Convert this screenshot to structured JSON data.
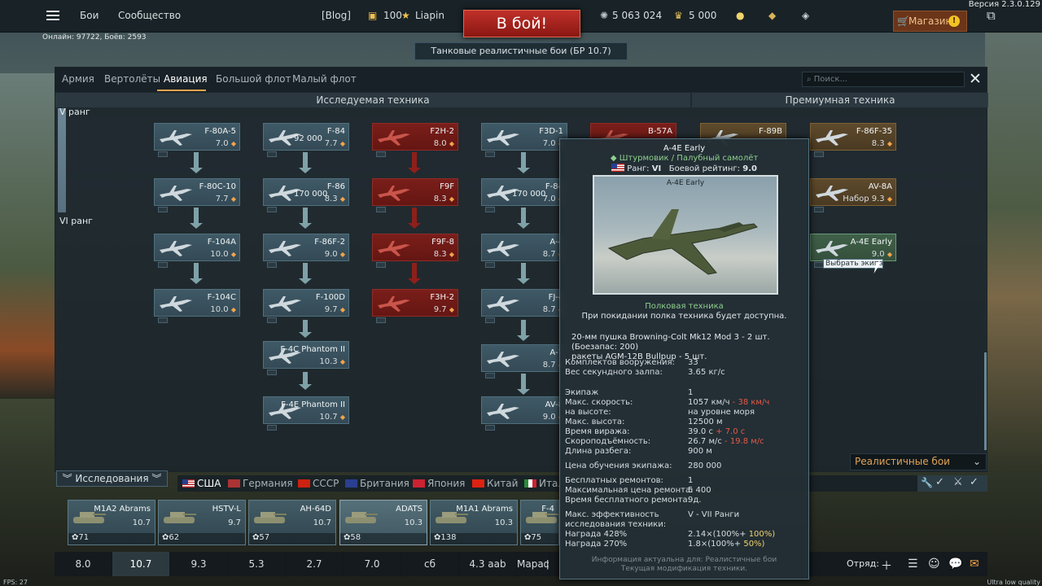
{
  "topbar": {
    "battles": "Бои",
    "community": "Сообщество",
    "blog": "[Blog]",
    "level": "100",
    "username": "Liapin",
    "battle_button": "В бой!",
    "silver": "5 063 024",
    "gold": "5 000",
    "shop": "Магазин",
    "version": "Версия 2.3.0.129",
    "online": "Онлайн: 97722, Боёв: 2593",
    "mode": "Танковые реалистичные бои (БР 10.7)"
  },
  "tabs": [
    {
      "label": "Армия"
    },
    {
      "label": "Вертолёты"
    },
    {
      "label": "Авиация"
    },
    {
      "label": "Большой флот"
    },
    {
      "label": "Малый флот"
    }
  ],
  "search_placeholder": "Поиск...",
  "sections": {
    "researched": "Исследуемая техника",
    "premium": "Премиумная техника"
  },
  "ranks": {
    "v": "V ранг",
    "vi": "VI ранг"
  },
  "vehicles": [
    {
      "name": "F-80A-5",
      "br": "7.0",
      "type": "normal"
    },
    {
      "name": "F-80C-10",
      "br": "7.7",
      "type": "normal"
    },
    {
      "name": "F-104A",
      "br": "10.0",
      "type": "normal"
    },
    {
      "name": "F-104C",
      "br": "10.0",
      "type": "normal"
    },
    {
      "name": "F-84",
      "br": "7.7",
      "xp": "92 000",
      "type": "normal"
    },
    {
      "name": "F-86",
      "br": "8.3",
      "xp": "170 000",
      "type": "normal"
    },
    {
      "name": "F-86F-2",
      "br": "9.0",
      "type": "normal"
    },
    {
      "name": "F-100D",
      "br": "9.7",
      "type": "normal"
    },
    {
      "name": "F-4C Phantom II",
      "br": "10.3",
      "type": "normal"
    },
    {
      "name": "F-4E Phantom II",
      "br": "10.7",
      "type": "normal"
    },
    {
      "name": "F2H-2",
      "br": "8.0",
      "type": "red"
    },
    {
      "name": "F9F",
      "br": "8.3",
      "type": "red"
    },
    {
      "name": "F9F-8",
      "br": "8.3",
      "type": "red"
    },
    {
      "name": "F3H-2",
      "br": "9.7",
      "type": "red"
    },
    {
      "name": "F3D-1",
      "br": "7.0",
      "type": "normal"
    },
    {
      "name": "F-84",
      "br": "7.0",
      "xp": "170 000",
      "type": "normal"
    },
    {
      "name": "A-4",
      "br": "8.7",
      "type": "normal"
    },
    {
      "name": "FJ-4",
      "br": "8.7",
      "type": "normal"
    },
    {
      "name": "A-7",
      "br": "8.7",
      "type": "normal"
    },
    {
      "name": "AV-8",
      "br": "9.0",
      "type": "normal"
    },
    {
      "name": "B-57A",
      "br": "",
      "type": "red"
    },
    {
      "name": "F-89B",
      "br": "",
      "type": "gold"
    },
    {
      "name": "F-86F-35",
      "br": "8.3",
      "type": "gold"
    },
    {
      "name": "AV-8A",
      "br": "Набор 9.3",
      "type": "gold"
    },
    {
      "name": "A-4E Early",
      "br": "9.0",
      "type": "sel"
    }
  ],
  "pick_crew": "Выбрать экипаж",
  "mode_select": "Реалистичные бои",
  "research_label": "Исследования",
  "nations": [
    {
      "name": "США"
    },
    {
      "name": "Германия"
    },
    {
      "name": "СССР"
    },
    {
      "name": "Британия"
    },
    {
      "name": "Япония"
    },
    {
      "name": "Китай"
    },
    {
      "name": "Италия"
    }
  ],
  "slots": [
    {
      "name": "M1A2 Abrams",
      "br": "10.7",
      "crew": "71"
    },
    {
      "name": "HSTV-L",
      "br": "9.7",
      "crew": "62"
    },
    {
      "name": "AH-64D",
      "br": "10.7",
      "crew": "57"
    },
    {
      "name": "ADATS",
      "br": "10.3",
      "crew": "58"
    },
    {
      "name": "M1A1 Abrams",
      "br": "10.3",
      "crew": "138"
    },
    {
      "name": "F-4",
      "br": "",
      "crew": "75"
    }
  ],
  "presets": [
    {
      "label": "8.0"
    },
    {
      "label": "10.7"
    },
    {
      "label": "9.3"
    },
    {
      "label": "5.3"
    },
    {
      "label": "2.7"
    },
    {
      "label": "7.0"
    },
    {
      "label": "сб"
    },
    {
      "label": "4.3 aab"
    },
    {
      "label": "Марафон"
    }
  ],
  "squad": "Отряд:",
  "fps": "FPS: 27",
  "quality": "Ultra low quality",
  "tooltip": {
    "title": "A-4E Early",
    "class": "Штурмовик / Палубный самолёт",
    "rank_label": "Ранг:",
    "rank": "VI",
    "br_label": "Боевой рейтинг:",
    "br": "9.0",
    "image_caption": "A-4E Early",
    "reg_title": "Полковая техника",
    "reg_note": "При покидании полка техника будет доступна.",
    "armament_1": "20-мм пушка Browning-Colt Mk12 Mod 3 - 2 шт. (Боезапас: 200)",
    "armament_2": "ракеты AGM-12B Bullpup - 5 шт.",
    "rows": [
      {
        "k": "Комплектов вооружения:",
        "v": "33",
        "extra": ""
      },
      {
        "k": "Вес секундного залпа:",
        "v": "3.65 кг/с",
        "extra": ""
      },
      {
        "k": "Экипаж",
        "v": "1",
        "extra": ""
      },
      {
        "k": "Макс. скорость:",
        "v": "1057 км/ч",
        "extra": "- 38 км/ч"
      },
      {
        "k": "на высоте:",
        "v": "на уровне моря",
        "extra": ""
      },
      {
        "k": "Макс. высота:",
        "v": "12500 м",
        "extra": ""
      },
      {
        "k": "Время виража:",
        "v": "39.0 с",
        "extra": "+ 7.0 с"
      },
      {
        "k": "Скороподъёмность:",
        "v": "26.7 м/с",
        "extra": "- 19.8 м/с"
      },
      {
        "k": "Длина разбега:",
        "v": "900 м",
        "extra": ""
      },
      {
        "k": "Цена обучения экипажа:",
        "v": "280 000",
        "extra": ""
      },
      {
        "k": "Бесплатных ремонтов:",
        "v": "1",
        "extra": ""
      },
      {
        "k": "Максимальная цена ремонта:",
        "v": "5 400",
        "extra": ""
      },
      {
        "k": "Время бесплатного ремонта:",
        "v": "9д.",
        "extra": ""
      },
      {
        "k": "Макс. эффективность",
        "v": "V - VII Ранги",
        "extra": ""
      },
      {
        "k": "исследования техники:",
        "v": "",
        "extra": ""
      },
      {
        "k": "Награда 428%",
        "v": "2.14×(100%+",
        "extra": "100%)"
      },
      {
        "k": "Награда 270%",
        "v": "1.8×(100%+",
        "extra": "50%)"
      }
    ],
    "footer_1": "Информация актуальна для: Реалистичные бои",
    "footer_2": "Текущая модификация техники."
  }
}
